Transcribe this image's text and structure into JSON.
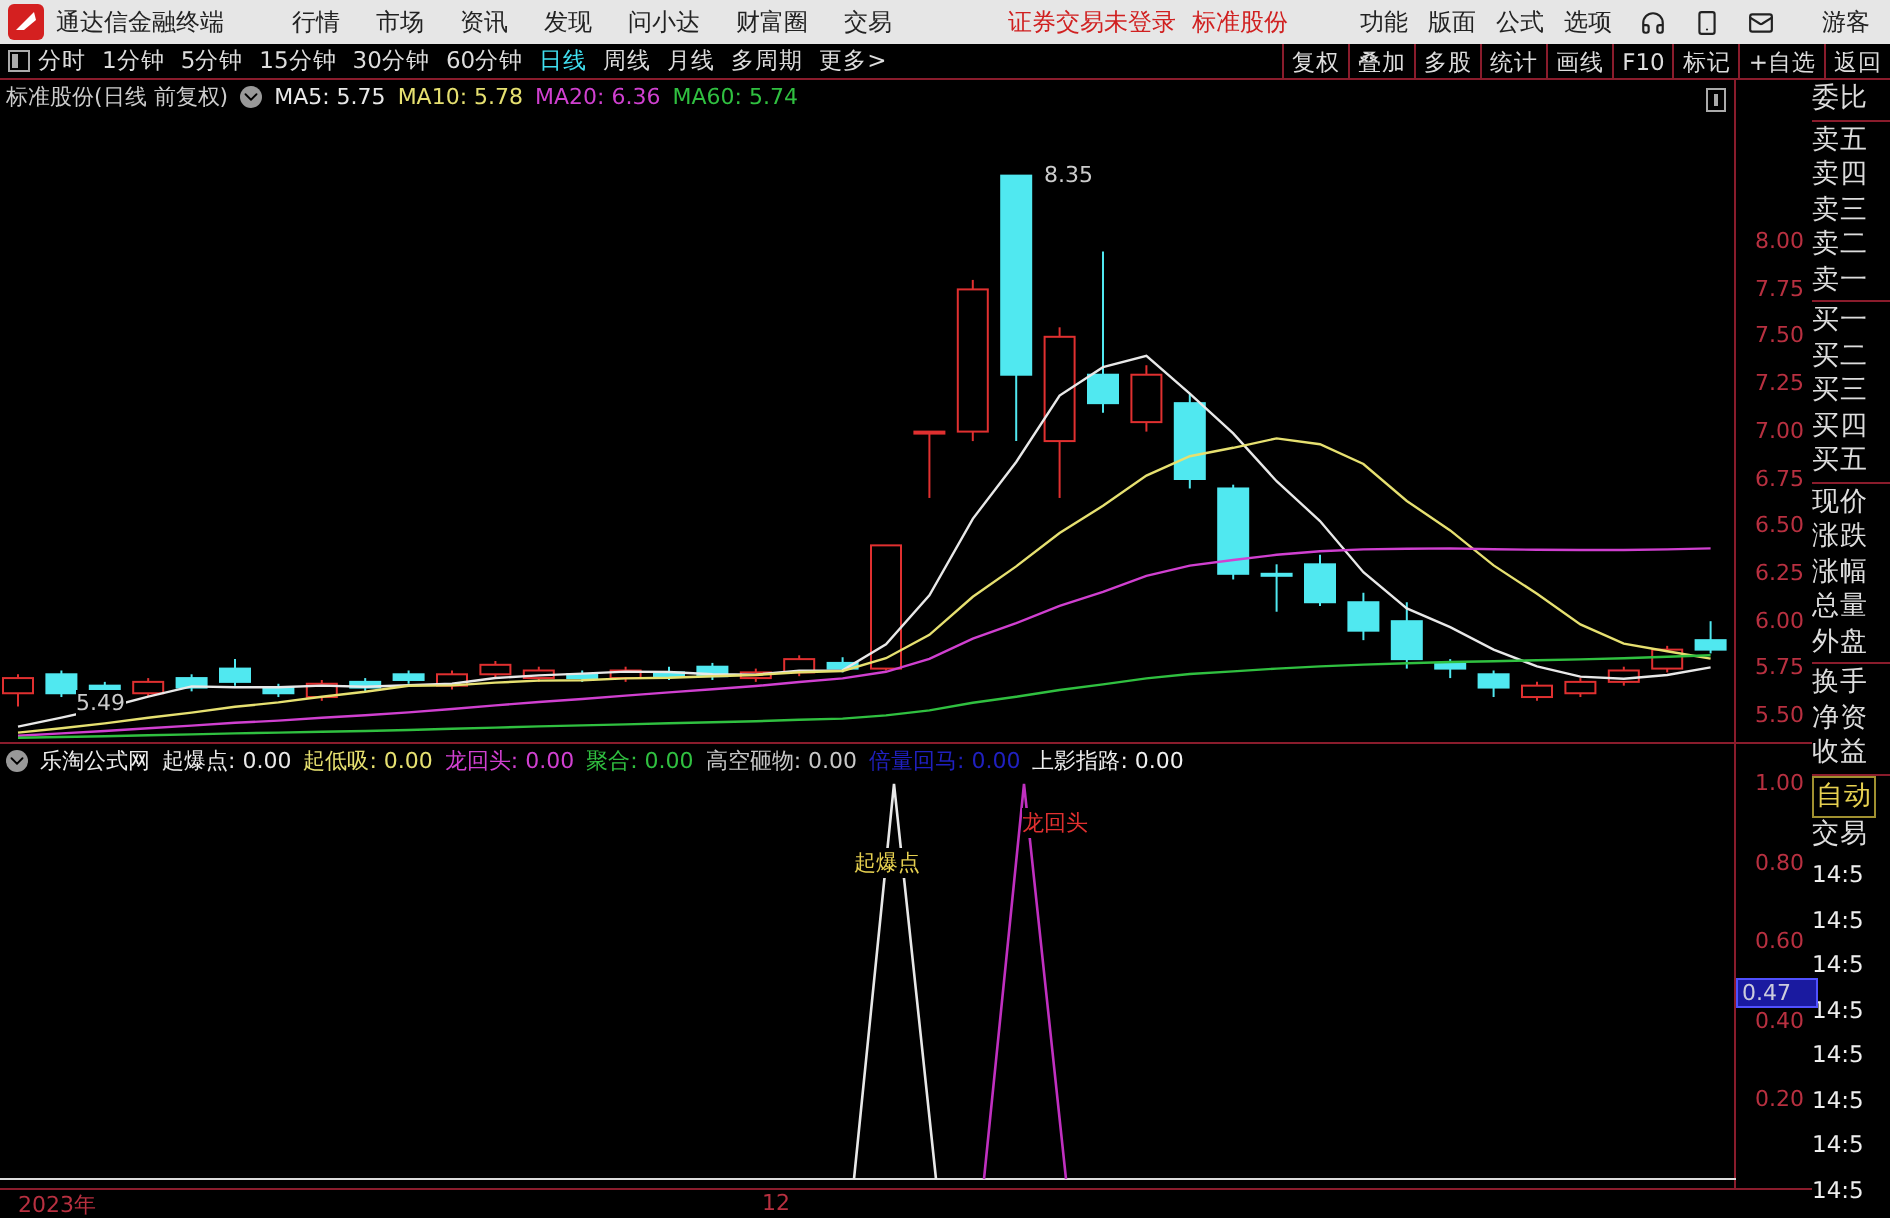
{
  "app_bar": {
    "title": "通达信金融终端",
    "menu": [
      "行情",
      "市场",
      "资讯",
      "发现",
      "问小达",
      "财富圈",
      "交易"
    ],
    "status": [
      "证券交易未登录",
      "标准股份"
    ],
    "actions": [
      "功能",
      "版面",
      "公式",
      "选项"
    ],
    "user": "游客"
  },
  "toolbar": {
    "periods": [
      {
        "label": "分时",
        "selected": false
      },
      {
        "label": "1分钟",
        "selected": false
      },
      {
        "label": "5分钟",
        "selected": false
      },
      {
        "label": "15分钟",
        "selected": false
      },
      {
        "label": "30分钟",
        "selected": false
      },
      {
        "label": "60分钟",
        "selected": false
      },
      {
        "label": "日线",
        "selected": true
      },
      {
        "label": "周线",
        "selected": false
      },
      {
        "label": "月线",
        "selected": false
      },
      {
        "label": "多周期",
        "selected": false
      },
      {
        "label": "更多>",
        "selected": false
      }
    ],
    "tools": [
      "复权",
      "叠加",
      "多股",
      "统计",
      "画线",
      "F10",
      "标记",
      "+自选",
      "返回"
    ]
  },
  "main_chart": {
    "title": "标准股份(日线 前复权)",
    "averages": [
      {
        "label": "MA5: 5.75",
        "color": "#e8e8e8"
      },
      {
        "label": "MA10: 5.78",
        "color": "#e6e070"
      },
      {
        "label": "MA20: 6.36",
        "color": "#d040d0"
      },
      {
        "label": "MA60: 5.74",
        "color": "#30c040"
      }
    ],
    "high_label": "8.35",
    "low_label": "5.49",
    "price_ticks": [
      "8.00",
      "7.75",
      "7.50",
      "7.25",
      "7.00",
      "6.75",
      "6.50",
      "6.25",
      "6.00",
      "5.75",
      "5.50"
    ]
  },
  "indicator": {
    "name": "乐淘公式网",
    "values": [
      {
        "label": "起爆点: 0.00",
        "color": "#e8e8e8"
      },
      {
        "label": "起低吸: 0.00",
        "color": "#e6e070"
      },
      {
        "label": "龙回头: 0.00",
        "color": "#d040d0"
      },
      {
        "label": "聚合: 0.00",
        "color": "#30c040"
      },
      {
        "label": "高空砸物: 0.00",
        "color": "#c8c8c8"
      },
      {
        "label": "倍量回马: 0.00",
        "color": "#2020c0"
      },
      {
        "label": "上影指路: 0.00",
        "color": "#f0f0f0"
      }
    ],
    "markers": [
      {
        "label": "起爆点",
        "color": "#e6d050"
      },
      {
        "label": "龙回头",
        "color": "#e03030"
      }
    ],
    "ticks": [
      "1.00",
      "0.80",
      "0.60",
      "0.40",
      "0.20"
    ],
    "current_value": "0.47"
  },
  "time_axis": [
    "2023年",
    "12"
  ],
  "quote_panel": {
    "groups": [
      [
        "委比"
      ],
      [
        "卖五",
        "卖四",
        "卖三",
        "卖二",
        "卖一"
      ],
      [
        "买一",
        "买二",
        "买三",
        "买四",
        "买五"
      ],
      [
        "现价",
        "涨跌",
        "涨幅",
        "总量",
        "外盘"
      ],
      [
        "换手",
        "净资",
        "收益"
      ]
    ],
    "mode": "自动",
    "trade": "交易",
    "times": [
      "14:5",
      "14:5",
      "14:5",
      "14:5",
      "14:5",
      "14:5",
      "14:5",
      "14:5"
    ]
  }
}
